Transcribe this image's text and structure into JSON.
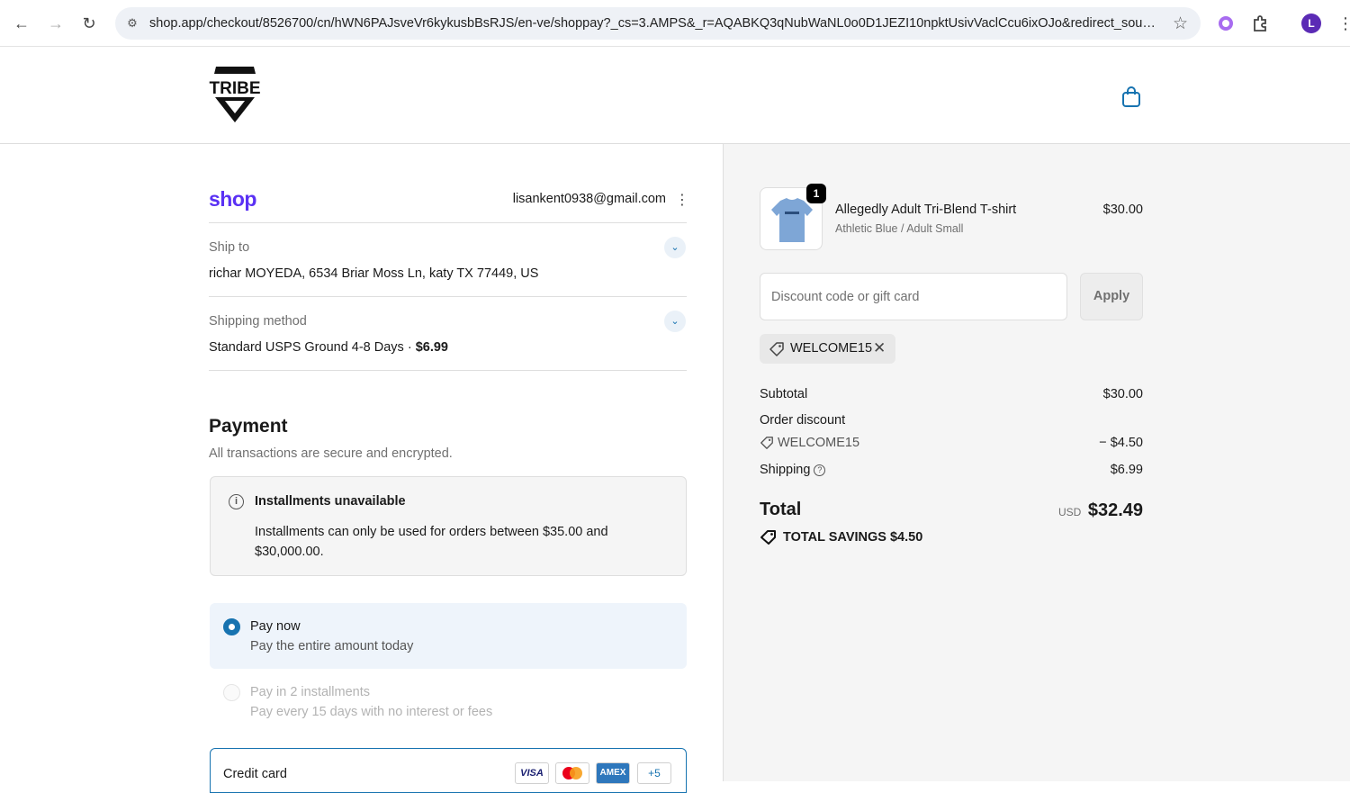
{
  "browser": {
    "url": "shop.app/checkout/8526700/cn/hWN6PAJsveVr6kykusbBsRJS/en-ve/shoppay?_cs=3.AMPS&_r=AQABKQ3qNubWaNL0o0D1JEZI10npktUsivVaclCcu6ixOJo&redirect_source…",
    "profile_initial": "L"
  },
  "header": {
    "logo_text": "TRIBE"
  },
  "contact": {
    "shop_brand": "shop",
    "email": "lisankent0938@gmail.com"
  },
  "ship_to": {
    "label": "Ship to",
    "value": "richar MOYEDA, 6534 Briar Moss Ln, katy TX 77449, US"
  },
  "shipping_method": {
    "label": "Shipping method",
    "name": "Standard USPS Ground 4-8 Days · ",
    "price": "$6.99"
  },
  "payment": {
    "title": "Payment",
    "subtitle": "All transactions are secure and encrypted.",
    "notice_title": "Installments unavailable",
    "notice_body": "Installments can only be used for orders between $35.00 and $30,000.00.",
    "options": [
      {
        "title": "Pay now",
        "subtitle": "Pay the entire amount today",
        "selected": true
      },
      {
        "title": "Pay in 2 installments",
        "subtitle": "Pay every 15 days with no interest or fees",
        "selected": false
      }
    ],
    "credit_card_label": "Credit card",
    "card_brands": [
      "VISA",
      "",
      "AMEX",
      "+5"
    ]
  },
  "order": {
    "quantity": "1",
    "product_name": "Allegedly Adult Tri-Blend T-shirt",
    "variant": "Athletic Blue / Adult Small",
    "price": "$30.00",
    "discount_placeholder": "Discount code or gift card",
    "apply_label": "Apply",
    "applied_code": "WELCOME15",
    "subtotal_label": "Subtotal",
    "subtotal": "$30.00",
    "discount_label": "Order discount",
    "discount_code": "WELCOME15",
    "discount_amount": "− $4.50",
    "shipping_label": "Shipping",
    "shipping": "$6.99",
    "total_label": "Total",
    "currency": "USD",
    "total": "$32.49",
    "savings_text": "TOTAL SAVINGS  $4.50"
  },
  "colors": {
    "accent": "#1773b0",
    "shop_purple": "#5a31f4"
  }
}
